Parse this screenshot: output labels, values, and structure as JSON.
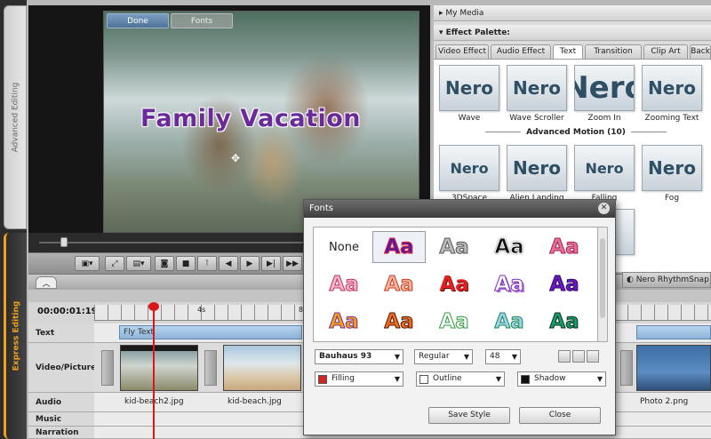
{
  "side_tabs": {
    "advanced": "Advanced Editing",
    "express": "Express Editing"
  },
  "preview": {
    "title_text": "Family Vacation",
    "done": "Done",
    "fonts": "Fonts"
  },
  "panel": {
    "my_media": "My Media",
    "effect_palette": "Effect Palette:",
    "tabs": [
      "Video Effect",
      "Audio Effect",
      "Text",
      "Transition",
      "Clip Art",
      "Back"
    ],
    "effects_row1": [
      "Wave",
      "Wave Scroller",
      "Zoom In",
      "Zooming Text"
    ],
    "advanced_motion": "Advanced Motion (10)",
    "effects_row2": [
      "3DSpace",
      "Alien Landing",
      "Falling",
      "Fog"
    ],
    "thumb_word": "Nero"
  },
  "timeline": {
    "timecode": "00:00:01:19",
    "ruler_labels": [
      "4s",
      "8s"
    ],
    "tracks": [
      "Text",
      "Video/Picture",
      "Audio",
      "Music",
      "Narration"
    ],
    "fly_text": "Fly Text",
    "clips": [
      "kid-beach2.jpg",
      "kid-beach.jpg",
      "Photo 2.png"
    ],
    "snap": "Nero RhythmSnap"
  },
  "fonts_dialog": {
    "title": "Fonts",
    "none_label": "None",
    "sample": "Aa",
    "font": "Bauhaus 93",
    "style": "Regular",
    "size": "48",
    "filling": "Filling",
    "outline": "Outline",
    "shadow": "Shadow",
    "save_style": "Save Style",
    "close": "Close"
  },
  "colors": {
    "accent": "#f0a01a",
    "filling": "#d32424",
    "shadow": "#111111",
    "outline": "#ffffff"
  }
}
